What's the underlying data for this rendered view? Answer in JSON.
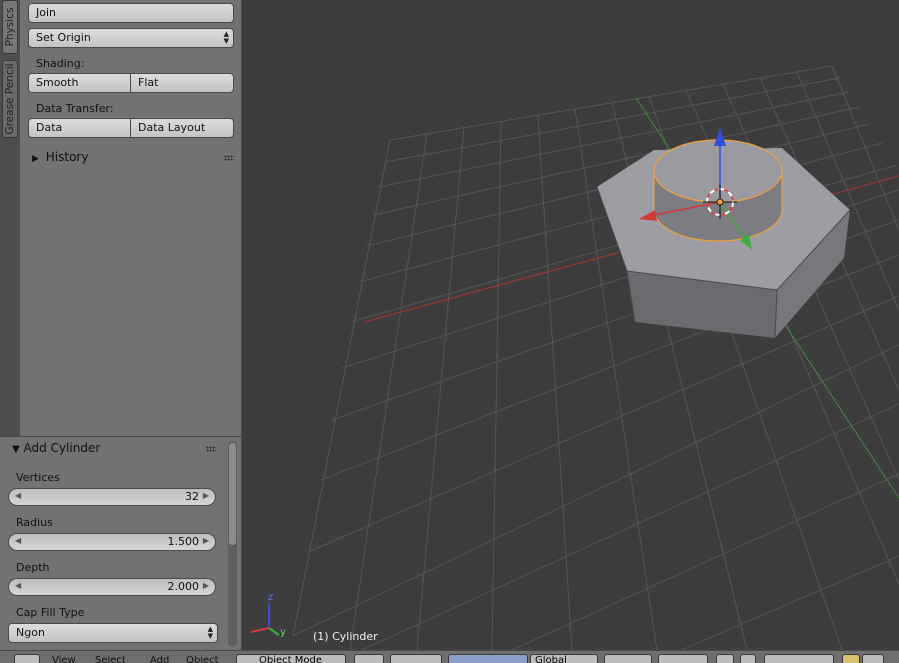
{
  "sidebar_tabs": [
    "Physics",
    "Grease Pencil"
  ],
  "tools": {
    "join_label": "Join",
    "set_origin_label": "Set Origin",
    "shading": {
      "label": "Shading:",
      "smooth_label": "Smooth",
      "flat_label": "Flat"
    },
    "data_transfer": {
      "label": "Data Transfer:",
      "data_label": "Data",
      "data_layout_label": "Data Layout"
    },
    "history_label": "History"
  },
  "operator": {
    "title": "Add Cylinder",
    "fields": [
      {
        "label": "Vertices",
        "value": "32"
      },
      {
        "label": "Radius",
        "value": "1.500"
      },
      {
        "label": "Depth",
        "value": "2.000"
      }
    ],
    "cap_fill_label": "Cap Fill Type",
    "cap_fill_value": "Ngon"
  },
  "viewport": {
    "object_label": "(1) Cylinder",
    "axis_labels": {
      "z": "z",
      "y": "y"
    },
    "colors": {
      "x_axis": "#d43a3a",
      "y_axis": "#3fae3f",
      "z_axis": "#2f4fd8",
      "selection": "#f0a040",
      "grid": "#555555"
    }
  },
  "bottom_bar": {
    "menu_items": [
      "View",
      "Select",
      "Add",
      "Object"
    ],
    "mode_label": "Object Mode",
    "pivot_label": "Global"
  }
}
